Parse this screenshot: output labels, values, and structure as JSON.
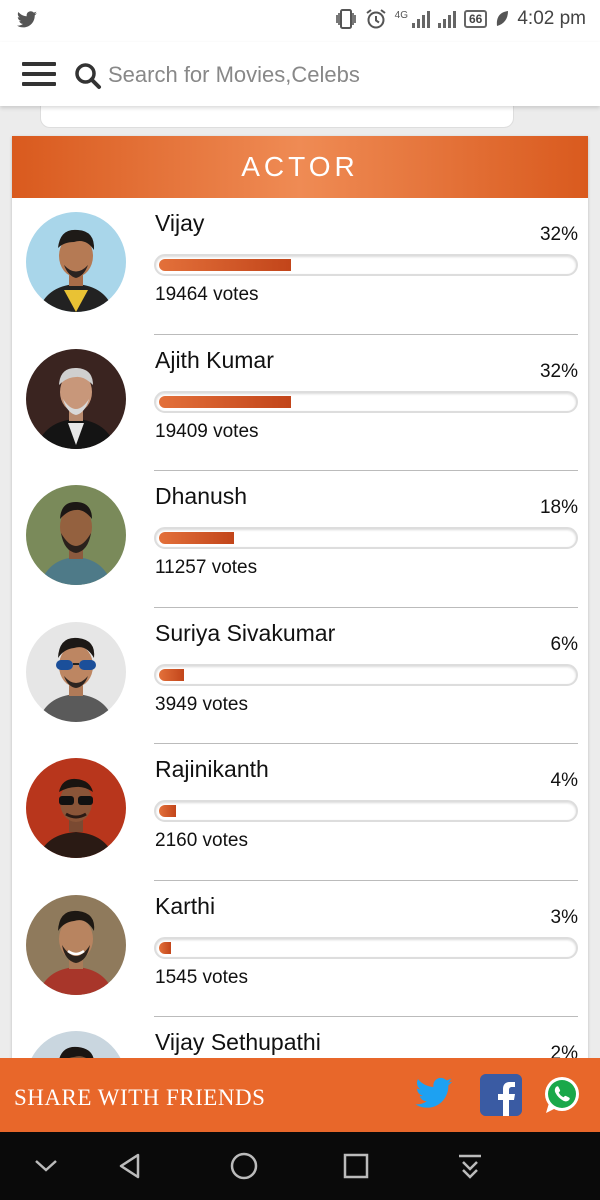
{
  "search": {
    "placeholder": "Search for Movies,Celebs"
  },
  "status_bar": {
    "time": "4:02 pm",
    "battery": "66",
    "network": "4G"
  },
  "poll": {
    "title": "ACTOR",
    "items": [
      {
        "name": "Vijay",
        "percent_label": "32%",
        "percent": 32,
        "votes_label": "19464 votes"
      },
      {
        "name": "Ajith Kumar",
        "percent_label": "32%",
        "percent": 32,
        "votes_label": "19409 votes"
      },
      {
        "name": "Dhanush",
        "percent_label": "18%",
        "percent": 18,
        "votes_label": "11257 votes"
      },
      {
        "name": "Suriya Sivakumar",
        "percent_label": "6%",
        "percent": 6,
        "votes_label": "3949 votes"
      },
      {
        "name": "Rajinikanth",
        "percent_label": "4%",
        "percent": 4,
        "votes_label": "2160 votes"
      },
      {
        "name": "Karthi",
        "percent_label": "3%",
        "percent": 3,
        "votes_label": "1545 votes"
      },
      {
        "name": "Vijay Sethupathi",
        "percent_label": "2%",
        "percent": 2,
        "votes_label": ""
      }
    ]
  },
  "share": {
    "label": "SHARE WITH FRIENDS"
  },
  "icons": {
    "status": [
      "twitter-icon",
      "vibrate-icon",
      "alarm-icon",
      "signal-icon",
      "battery-icon",
      "battery-saver-icon"
    ],
    "header": [
      "menu-icon",
      "search-icon"
    ],
    "share": [
      "twitter-icon",
      "facebook-icon",
      "whatsapp-icon"
    ],
    "nav": [
      "chevron-down-icon",
      "back-icon",
      "home-icon",
      "recents-icon",
      "download-icon"
    ]
  },
  "colors": {
    "accent": "#e8672a",
    "bar_fill": "#d0561f",
    "header_gradient_center": "#ef8b54",
    "twitter": "#1da1f2",
    "facebook": "#3a5ba3",
    "whatsapp": "#1aa84a"
  }
}
